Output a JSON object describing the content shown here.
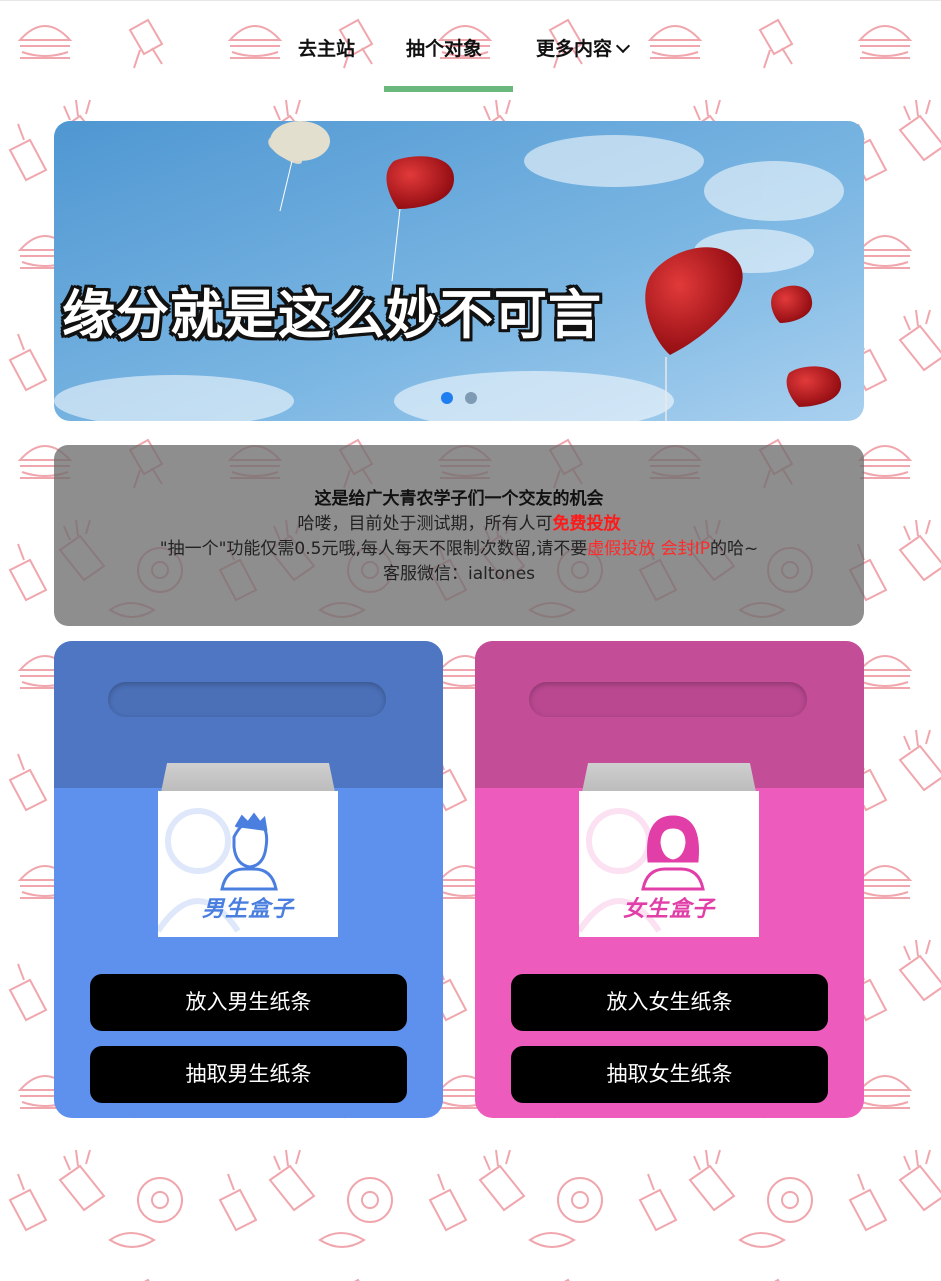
{
  "nav": {
    "items": [
      {
        "label": "去主站"
      },
      {
        "label": "抽个对象"
      },
      {
        "label": "更多内容"
      }
    ],
    "active_index": 1
  },
  "banner": {
    "caption": "缘分就是这么妙不可言",
    "slides_total": 2,
    "active_slide": 1
  },
  "notice": {
    "line1": "这是给广大青农学子们一个交友的机会",
    "line2_prefix": "哈喽，目前处于测试期，所有人可",
    "line2_highlight": "免费投放",
    "line3_prefix": "\"抽一个\"功能仅需0.5元哦,每人每天不限制次数留,请不要",
    "line3_highlight": "虚假投放 会封IP",
    "line3_suffix": "的哈~",
    "line4": "客服微信：ialtones"
  },
  "boy_card": {
    "box_label": "男生盒子",
    "put_button": "放入男生纸条",
    "draw_button": "抽取男生纸条",
    "accent": "#5e90ed"
  },
  "girl_card": {
    "box_label": "女生盒子",
    "put_button": "放入女生纸条",
    "draw_button": "抽取女生纸条",
    "accent": "#ed5cbc"
  },
  "colors": {
    "nav_underline": "#6bb87c",
    "highlight_red": "#ff2a2a",
    "pattern": "#f0a0a8"
  }
}
